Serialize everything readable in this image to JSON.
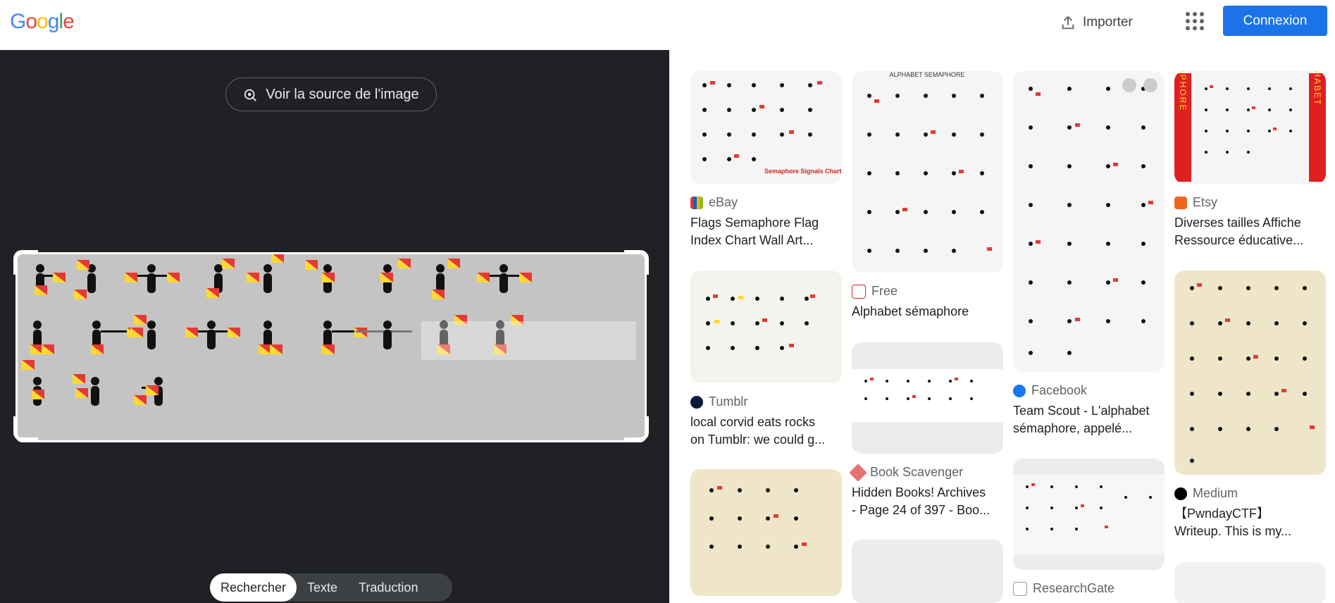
{
  "header": {
    "logo_parts": [
      "G",
      "o",
      "o",
      "g",
      "l",
      "e"
    ],
    "upload_label": "Importer",
    "signin_label": "Connexion"
  },
  "viewer": {
    "source_label": "Voir la source de l'image",
    "tabs": [
      {
        "label": "Rechercher",
        "active": true
      },
      {
        "label": "Texte",
        "active": false
      },
      {
        "label": "Traduction",
        "active": false
      }
    ]
  },
  "results": [
    {
      "source": "eBay",
      "title": "Flags Semaphore Flag\nIndex Chart Wall Art...",
      "thumb_text": "Semaphore Signals Chart"
    },
    {
      "source": "Free",
      "title": "Alphabet sémaphore",
      "thumb_text": "ALPHABET SEMAPHORE"
    },
    {
      "source": "Facebook",
      "title": "Team Scout - L'alphabet\nsémaphore, appelé..."
    },
    {
      "source": "Etsy",
      "title": "Diverses tailles Affiche\nRessource éducative...",
      "thumb_left": "SEMAPHORE",
      "thumb_right": "ALPHABET"
    },
    {
      "source": "Tumblr",
      "title": "local corvid eats rocks\non Tumblr: we could g..."
    },
    {
      "source": "Book Scavenger",
      "title": "Hidden Books! Archives\n- Page 24 of 397 - Boo..."
    },
    {
      "source": "Medium",
      "title": "【PwndayCTF】\nWriteup. This is my..."
    },
    {
      "source": "ResearchGate",
      "title": ""
    }
  ]
}
